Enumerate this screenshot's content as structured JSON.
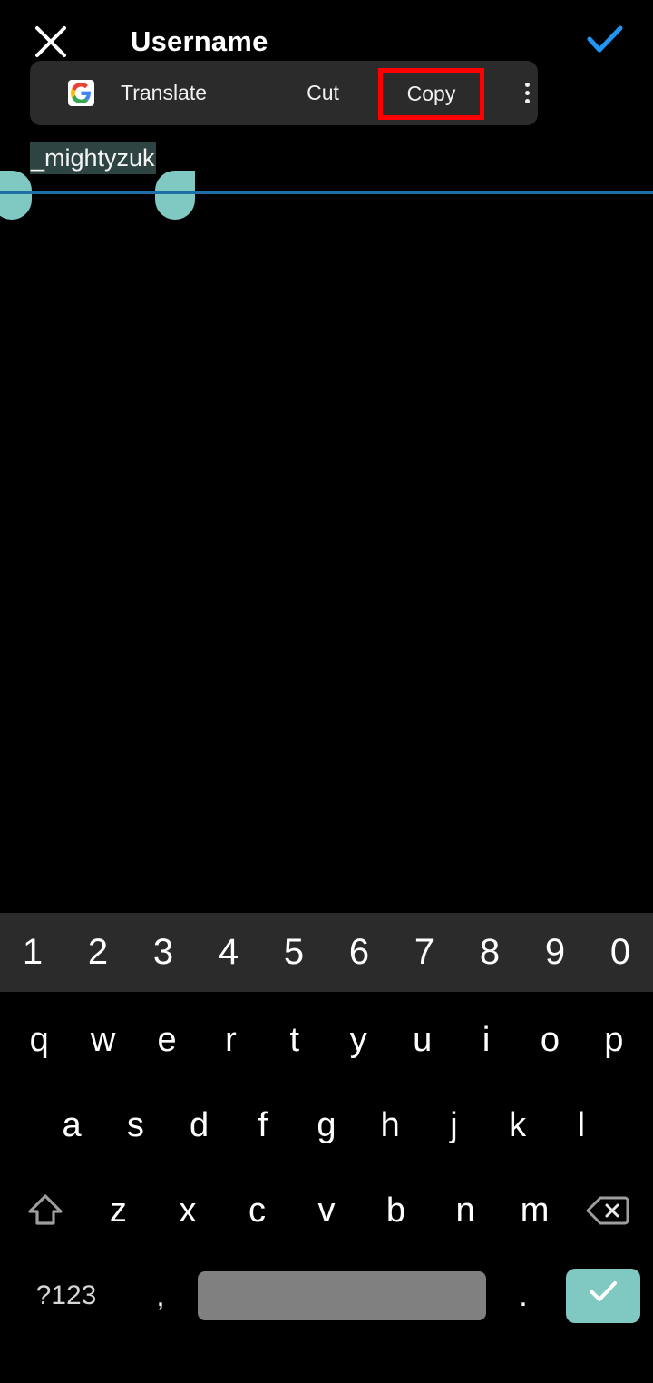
{
  "appbar": {
    "close_icon": "close-icon",
    "title": "Username",
    "confirm_icon": "check-icon",
    "confirm_color": "#2196f3"
  },
  "selection_toolbar": {
    "google_icon": "google-g-icon",
    "items": [
      {
        "label": "Translate",
        "name": "translate"
      },
      {
        "label": "Cut",
        "name": "cut"
      },
      {
        "label": "Copy",
        "name": "copy",
        "highlighted": true
      }
    ],
    "overflow_icon": "more-vertical-icon",
    "highlight_color": "#ff0000",
    "background": "#2b2b2b"
  },
  "text_field": {
    "label": "Username",
    "value": "_mightyzuk",
    "selected": true,
    "selection_highlight_color": "#2d4442",
    "handle_color": "#7fc9c2",
    "underline_color": "#1d6fa5"
  },
  "keyboard": {
    "number_row": [
      "1",
      "2",
      "3",
      "4",
      "5",
      "6",
      "7",
      "8",
      "9",
      "0"
    ],
    "row_1": [
      "q",
      "w",
      "e",
      "r",
      "t",
      "y",
      "u",
      "i",
      "o",
      "p"
    ],
    "row_2": [
      "a",
      "s",
      "d",
      "f",
      "g",
      "h",
      "j",
      "k",
      "l"
    ],
    "row_3": {
      "shift_icon": "shift-icon",
      "letters": [
        "z",
        "x",
        "c",
        "v",
        "b",
        "n",
        "m"
      ],
      "backspace_icon": "backspace-icon"
    },
    "row_4": {
      "symbols_label": "?123",
      "comma_label": ",",
      "space_label": "",
      "period_label": ".",
      "enter_icon": "check-icon",
      "enter_color": "#7fc9c2",
      "space_color": "#808080"
    },
    "background": "#000000",
    "number_row_background": "#2b2b2b"
  }
}
